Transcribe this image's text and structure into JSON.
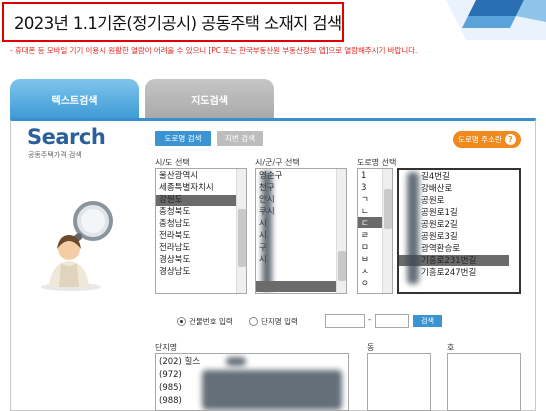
{
  "header": {
    "title": "2023년 1.1기준(정기공시) 공동주택 소재지 검색",
    "notice": "- 휴대폰 등 모바일 기기 이용시 원활한 열람이 어려울 수 있으니 [PC 또는 한국부동산원 부동산정보 앱]으로 열람해주시기 바랍니다."
  },
  "tabs": [
    {
      "label": "텍스트검색",
      "active": true
    },
    {
      "label": "지도검색",
      "active": false
    }
  ],
  "brand": {
    "search_title": "Search",
    "search_subtitle": "공동주택가격 검색"
  },
  "toolbar": {
    "road_button": "도로명 검색",
    "jibun_button": "지번 검색",
    "road_lookup_button": "도로명 주소란",
    "help_glyph": "?"
  },
  "columns": {
    "sido_label": "시/도 선택",
    "sigungu_label": "시/군/구 선택",
    "road_label": "도로명 선택"
  },
  "sido_items": [
    "울산광역시",
    "세종특별자치시",
    "",
    "강원도",
    "충청북도",
    "충청남도",
    "전라북도",
    "전라남도",
    "경상북도",
    "경상남도"
  ],
  "sigungu_items": [
    "영순구",
    "천구",
    "안시",
    "쿠시",
    "시",
    "시",
    "구",
    "시",
    "",
    ""
  ],
  "road_items": [
    "1",
    "3",
    "ㄱ",
    "ㄴ",
    "ㄷ",
    "ㄹ",
    "ㅁ",
    "ㅂ",
    "ㅅ",
    "ㅇ"
  ],
  "road_names": [
    "길4번길",
    "강배산로",
    "공원로",
    "공원로1길",
    "공원로2길",
    "공원로3길",
    "광역환승로",
    "",
    "기흥로231번길",
    "기흥로247번길"
  ],
  "search_row": {
    "radio_building": "건물번호 입력",
    "radio_complex": "단지명 입력",
    "search_button": "검색"
  },
  "bottom": {
    "complex_label": "단지명",
    "dong_label": "동",
    "ho_label": "호",
    "complex_items": [
      "(202) 힐스",
      "(972)",
      "(985)",
      "(988)"
    ]
  },
  "colors": {
    "accent_blue": "#3a94d1",
    "alert_red": "#e10000",
    "orange": "#f08a1f"
  }
}
